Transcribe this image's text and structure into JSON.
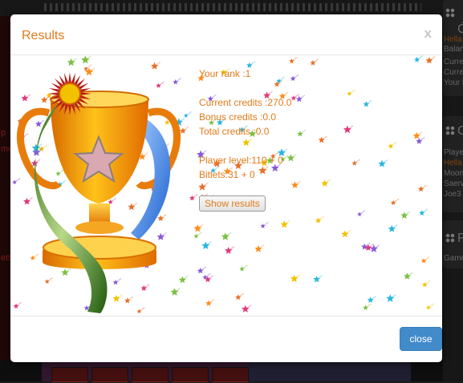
{
  "modal": {
    "title": "Results",
    "close_x": "x",
    "rank_line": "Your rank :1",
    "current_credits_line": "Current credits :270.0",
    "bonus_credits_line": "Bonus credits :0.0",
    "total_credits_line": "Total credits :0.0",
    "player_level_line": "Player level:110 + 0",
    "bitlets_line": "Bitlets:31 + 0",
    "show_results_label": "Show results",
    "close_label": "close"
  },
  "background": {
    "left_text_1": "p",
    "left_text_2": "me",
    "left_text_3": "ett",
    "right_panel_1": [
      "Ć",
      "Hella",
      "Balanc",
      "Curren",
      "Curren",
      "Your la"
    ],
    "right_panel_2": [
      "C",
      "Player",
      "Hella",
      "Moon",
      "Saerw",
      "Joe3"
    ],
    "right_panel_3": [
      "F",
      "Game"
    ]
  },
  "colors": {
    "accent": "#e07b1a",
    "close_button": "#428bca"
  }
}
